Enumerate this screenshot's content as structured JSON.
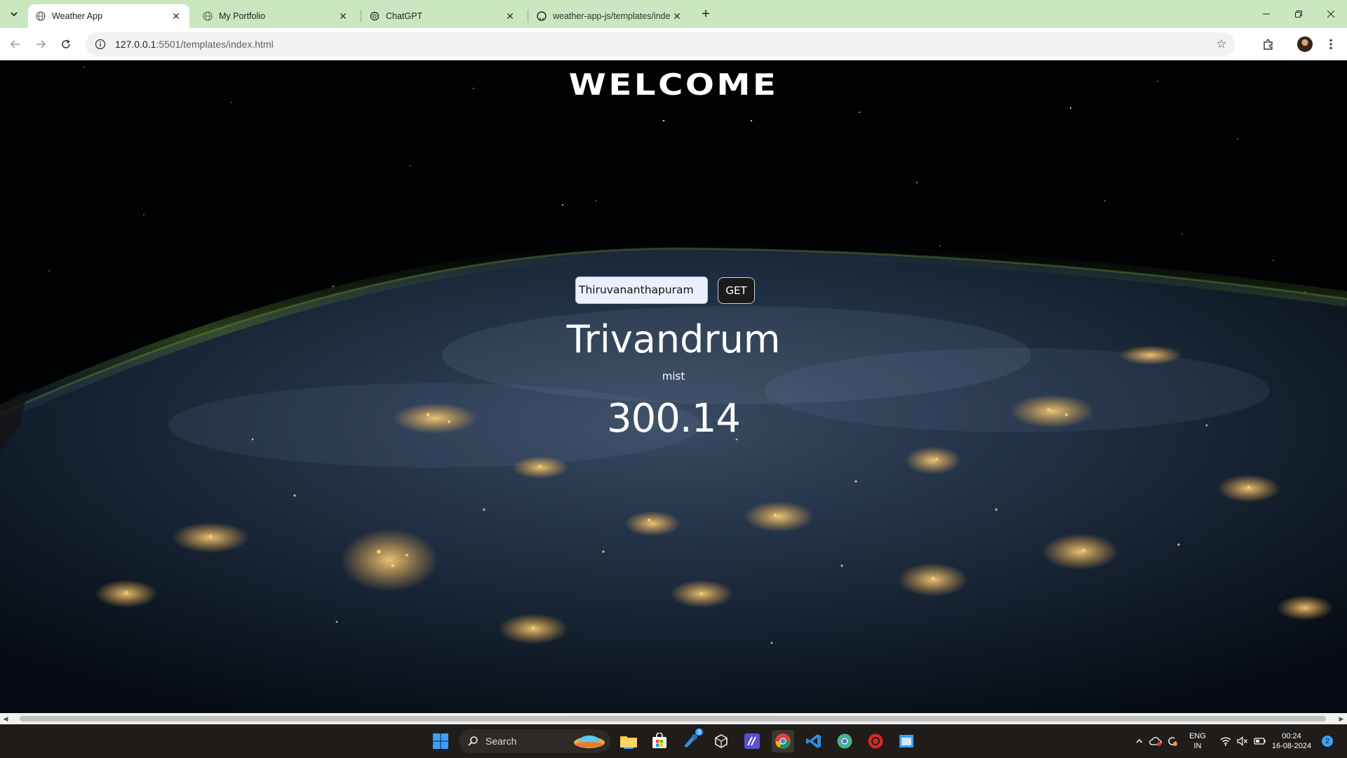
{
  "browser": {
    "tabs": [
      {
        "title": "Weather App",
        "active": true
      },
      {
        "title": "My Portfolio",
        "active": false
      },
      {
        "title": "ChatGPT",
        "active": false
      },
      {
        "title": "weather-app-js/templates/inde",
        "active": false
      }
    ],
    "url_host": "127.0.0.1",
    "url_path": ":5501/templates/index.html",
    "accent": "#c9e8c0"
  },
  "page": {
    "heading": "WELCOME",
    "city_input_value": "Thiruvananthapuram",
    "get_button_label": "GET",
    "city_name": "Trivandrum",
    "condition": "mist",
    "temperature": "300.14"
  },
  "taskbar": {
    "search_label": "Search",
    "language_line1": "ENG",
    "language_line2": "IN",
    "time": "00:24",
    "date": "16-08-2024",
    "notification_count": "2",
    "app_badge": "3"
  }
}
